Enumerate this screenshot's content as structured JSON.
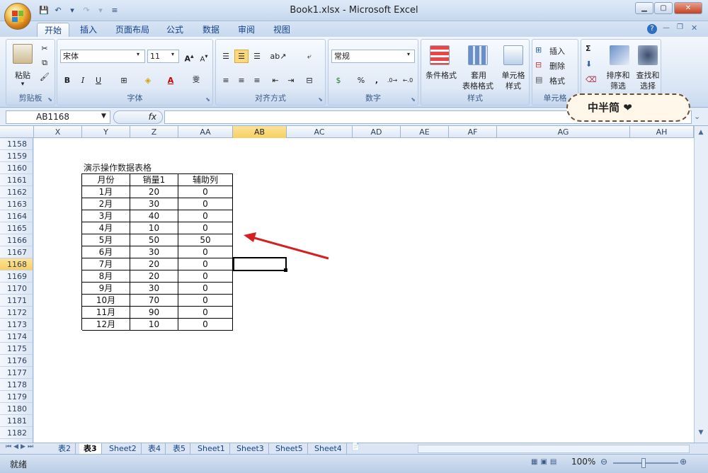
{
  "window": {
    "title": "Book1.xlsx - Microsoft Excel"
  },
  "ribbon_tabs": [
    "开始",
    "插入",
    "页面布局",
    "公式",
    "数据",
    "审阅",
    "视图"
  ],
  "clipboard": {
    "paste": "粘贴",
    "label": "剪贴板"
  },
  "font": {
    "name": "宋体",
    "size": "11",
    "label": "字体",
    "bold": "B",
    "italic": "I",
    "underline": "U"
  },
  "alignment": {
    "label": "对齐方式"
  },
  "number": {
    "format": "常规",
    "label": "数字",
    "percent": "%",
    "comma": ","
  },
  "styles": {
    "conditional": "条件格式",
    "table1": "套用",
    "table2": "表格格式",
    "cell1": "单元格",
    "cell2": "样式",
    "label": "样式"
  },
  "cells": {
    "insert": "插入",
    "delete": "删除",
    "format": "格式",
    "label": "单元格"
  },
  "editing": {
    "sort1": "排序和",
    "sort2": "筛选",
    "find1": "查找和",
    "find2": "选择",
    "sigma": "Σ"
  },
  "formula_bar": {
    "name_box": "AB1168",
    "fx": "fx"
  },
  "columns": [
    "X",
    "Y",
    "Z",
    "AA",
    "AB",
    "AC",
    "AD",
    "AE",
    "AF",
    "AG",
    "AH"
  ],
  "selected_column": "AB",
  "rows": [
    "1158",
    "1159",
    "1160",
    "1161",
    "1162",
    "1163",
    "1164",
    "1165",
    "1166",
    "1167",
    "1168",
    "1169",
    "1170",
    "1171",
    "1172",
    "1173",
    "1174",
    "1175",
    "1176",
    "1177",
    "1178",
    "1179",
    "1180",
    "1181",
    "1182"
  ],
  "selected_row": "1168",
  "table": {
    "caption": "演示操作数据表格",
    "headers": [
      "月份",
      "销量1",
      "辅助列"
    ],
    "rows": [
      [
        "1月",
        "20",
        "0"
      ],
      [
        "2月",
        "30",
        "0"
      ],
      [
        "3月",
        "40",
        "0"
      ],
      [
        "4月",
        "10",
        "0"
      ],
      [
        "5月",
        "50",
        "50"
      ],
      [
        "6月",
        "30",
        "0"
      ],
      [
        "7月",
        "20",
        "0"
      ],
      [
        "8月",
        "20",
        "0"
      ],
      [
        "9月",
        "30",
        "0"
      ],
      [
        "10月",
        "70",
        "0"
      ],
      [
        "11月",
        "90",
        "0"
      ],
      [
        "12月",
        "10",
        "0"
      ]
    ]
  },
  "sheet_tabs": [
    "表2",
    "表3",
    "Sheet2",
    "表4",
    "表5",
    "Sheet1",
    "Sheet3",
    "Sheet5",
    "Sheet4"
  ],
  "active_sheet": "表3",
  "status": {
    "ready": "就绪",
    "zoom": "100%"
  },
  "sticker": {
    "text": "中半简 ❤"
  },
  "colors": {
    "accent": "#15428b",
    "arrow": "#d42020",
    "selected_header": "#f8cf5f"
  }
}
